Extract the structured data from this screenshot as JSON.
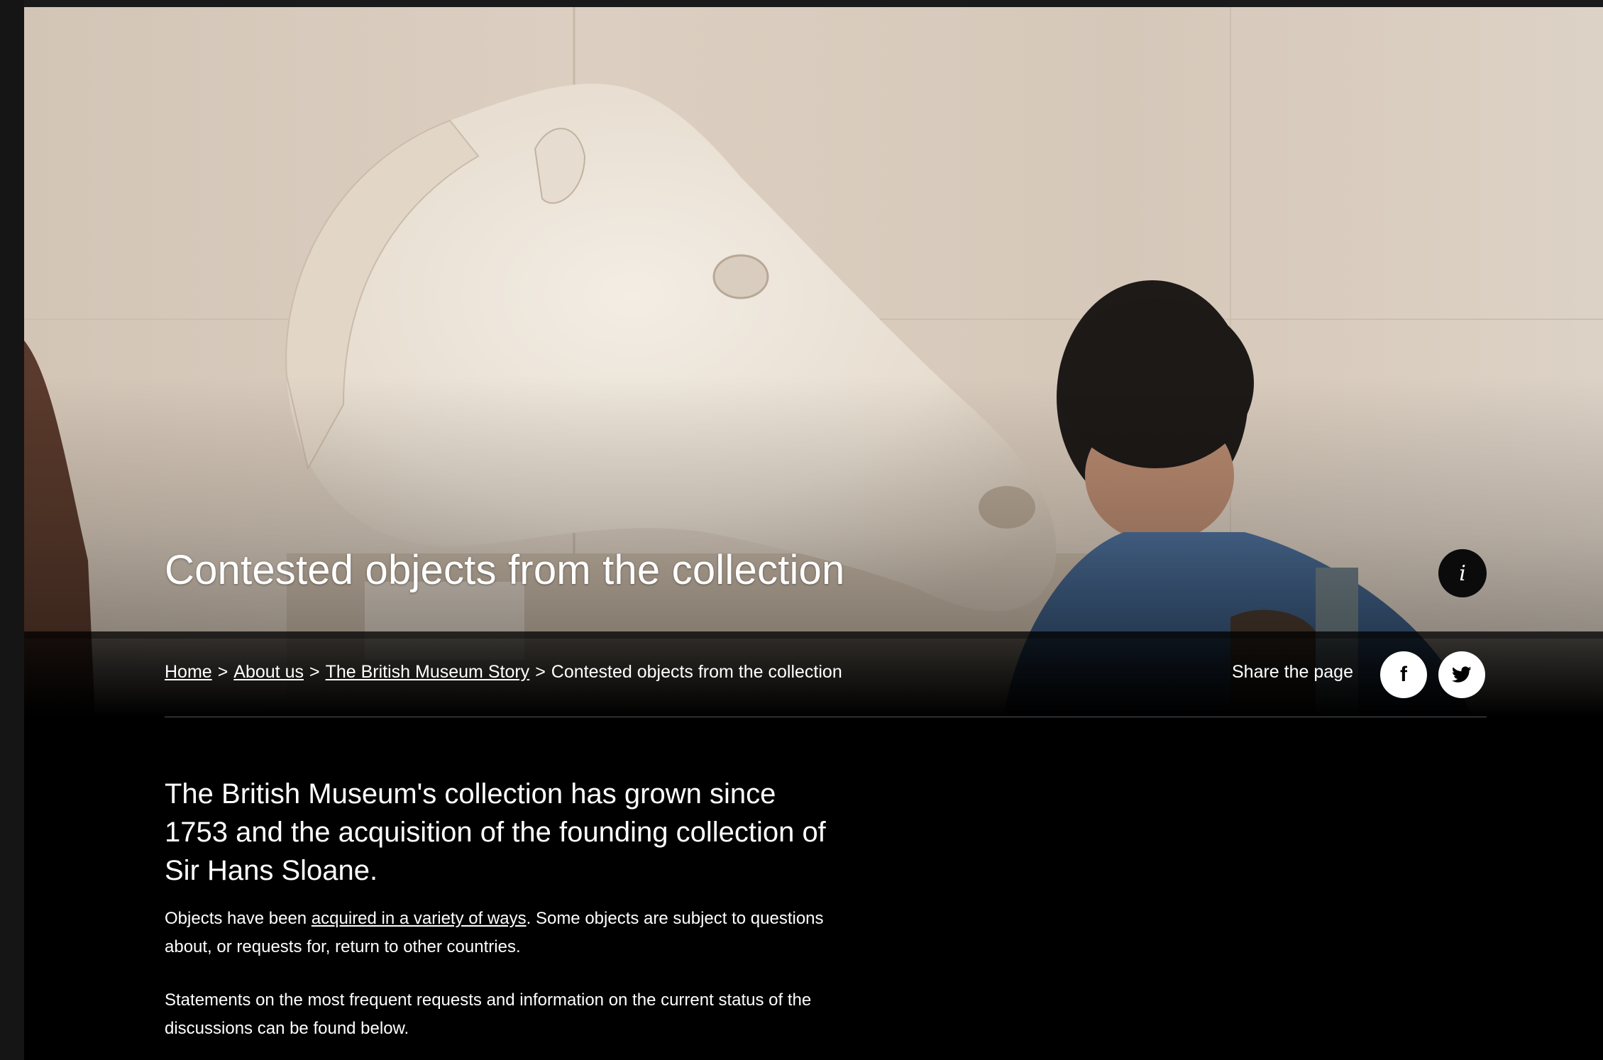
{
  "hero": {
    "title": "Contested objects from the collection",
    "info_icon": "info-icon"
  },
  "breadcrumb": {
    "items": [
      {
        "label": "Home"
      },
      {
        "label": "About us"
      },
      {
        "label": "The British Museum Story"
      }
    ],
    "current": "Contested objects from the collection",
    "separator": ">"
  },
  "share": {
    "label": "Share the page",
    "buttons": [
      {
        "icon": "facebook-icon",
        "glyph": "f"
      },
      {
        "icon": "twitter-icon"
      }
    ]
  },
  "intro": {
    "heading": "The British Museum's collection has grown since 1753 and the acquisition of the founding collection of Sir Hans Sloane.",
    "p1_before": "Objects have been ",
    "p1_link": "acquired in a variety of ways",
    "p1_after": ". Some objects are subject to questions about, or requests for, return to other countries.",
    "p2": "Statements on the most frequent requests and information on the current status of the discussions can be found below."
  },
  "colors": {
    "page_background": "#000000",
    "text": "#ffffff",
    "gallery_wall": "#d9cbbd",
    "marble": "#ece4d8",
    "jacket": "#3e5f8a"
  }
}
